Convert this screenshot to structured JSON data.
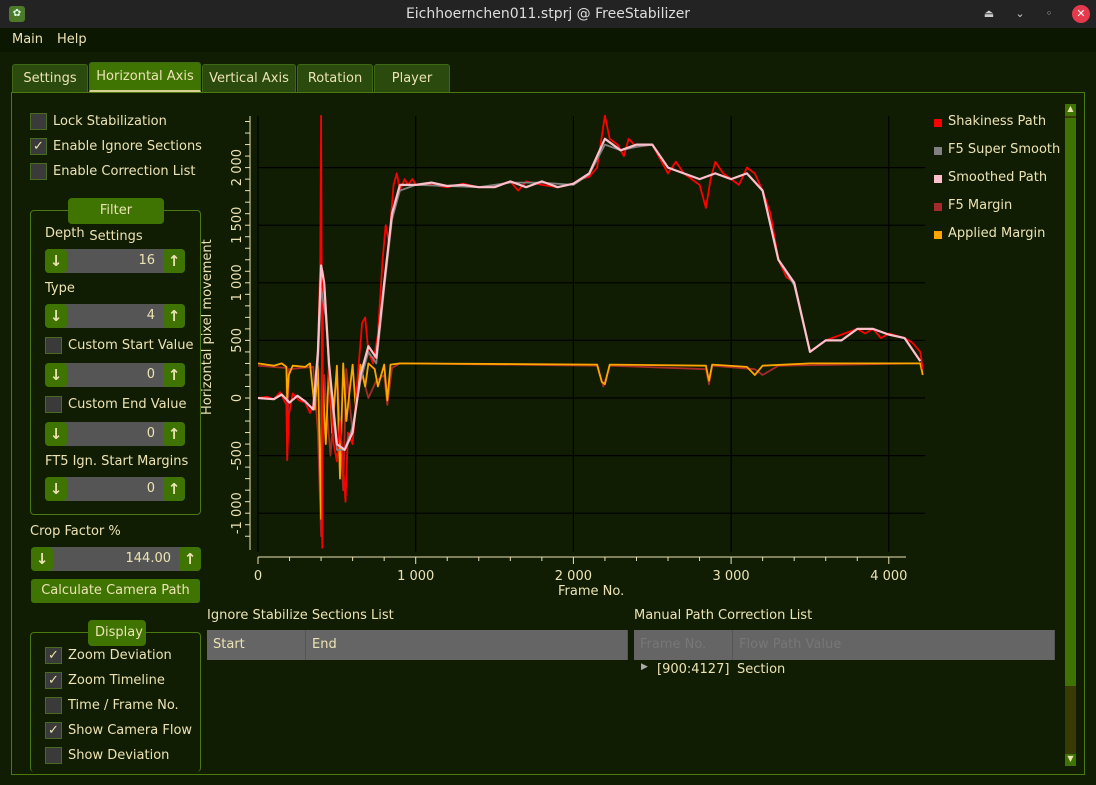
{
  "window": {
    "title": "Eichhoernchen011.stprj @ FreeStabilizer",
    "icon": "app-squirrel-icon",
    "controls": [
      "keep-above-icon",
      "minimize-icon",
      "restore-icon",
      "close-icon"
    ]
  },
  "menu": [
    "Main",
    "Help"
  ],
  "tabs": [
    {
      "label": "Settings"
    },
    {
      "label": "Horizontal Axis",
      "active": true
    },
    {
      "label": "Vertical Axis"
    },
    {
      "label": "Rotation"
    },
    {
      "label": "Player"
    }
  ],
  "options": {
    "lock": {
      "label": "Lock Stabilization",
      "checked": false
    },
    "ignore": {
      "label": "Enable Ignore Sections",
      "checked": true
    },
    "correction": {
      "label": "Enable Correction List",
      "checked": false
    }
  },
  "filter": {
    "title": "Filter Settings",
    "depth_label": "Depth",
    "depth": "16",
    "type_label": "Type",
    "type": "4",
    "custom_start_label": "Custom Start Value",
    "custom_start_checked": false,
    "custom_start": "0",
    "custom_end_label": "Custom End Value",
    "custom_end_checked": false,
    "custom_end": "0",
    "ft5_label": "FT5 Ign. Start Margins",
    "ft5": "0"
  },
  "crop": {
    "label": "Crop Factor %",
    "value": "144.00"
  },
  "calc_button": "Calculate Camera Path",
  "display": {
    "title": "Display",
    "items": [
      {
        "label": "Zoom Deviation",
        "checked": true
      },
      {
        "label": "Zoom Timeline",
        "checked": true
      },
      {
        "label": " Time / Frame No.",
        "checked": false
      },
      {
        "label": "Show Camera Flow",
        "checked": true
      },
      {
        "label": "Show Deviation",
        "checked": false
      }
    ]
  },
  "ignore_list": {
    "title": "Ignore Stabilize Sections List",
    "columns": [
      "Start",
      "End"
    ]
  },
  "correction_list": {
    "title": "Manual Path Correction List",
    "columns": [
      "Frame No.",
      "Flow Path Value"
    ],
    "rows": [
      {
        "frames": "[900:4127]",
        "value": "Section"
      }
    ]
  },
  "colors": {
    "accent": "#3f7403",
    "text": "#ece3b4",
    "background": "#111d02"
  },
  "chart_data": {
    "type": "line",
    "xlabel": "Frame No.",
    "ylabel": "Horizontal pixel movement",
    "xlim": [
      0,
      4220
    ],
    "ylim": [
      -1300,
      2450
    ],
    "grid": true,
    "legend_placement": "right",
    "xticks": [
      "0",
      "1 000",
      "2 000",
      "3 000",
      "4 000"
    ],
    "xtick_values": [
      0,
      1000,
      2000,
      3000,
      4000
    ],
    "yticks": [
      "-1 000",
      "-500",
      "0",
      "500",
      "1 000",
      "1 500",
      "2 000"
    ],
    "ytick_values": [
      -1000,
      -500,
      0,
      500,
      1000,
      1500,
      2000
    ],
    "series": [
      {
        "name": "Shakiness Path",
        "color": "#ff0000",
        "points": [
          [
            0,
            0
          ],
          [
            60,
            10
          ],
          [
            100,
            -10
          ],
          [
            140,
            50
          ],
          [
            180,
            -60
          ],
          [
            185,
            -540
          ],
          [
            195,
            -150
          ],
          [
            220,
            40
          ],
          [
            260,
            -20
          ],
          [
            300,
            -40
          ],
          [
            330,
            -130
          ],
          [
            350,
            -60
          ],
          [
            380,
            400
          ],
          [
            395,
            1200
          ],
          [
            400,
            2450
          ],
          [
            403,
            1300
          ],
          [
            408,
            -1300
          ],
          [
            412,
            1100
          ],
          [
            430,
            800
          ],
          [
            450,
            200
          ],
          [
            480,
            -400
          ],
          [
            500,
            -550
          ],
          [
            520,
            -200
          ],
          [
            540,
            -600
          ],
          [
            555,
            -900
          ],
          [
            570,
            -300
          ],
          [
            600,
            -400
          ],
          [
            630,
            150
          ],
          [
            660,
            650
          ],
          [
            680,
            700
          ],
          [
            700,
            400
          ],
          [
            730,
            300
          ],
          [
            760,
            550
          ],
          [
            790,
            1200
          ],
          [
            810,
            1500
          ],
          [
            830,
            1350
          ],
          [
            860,
            1850
          ],
          [
            880,
            1950
          ],
          [
            900,
            1800
          ],
          [
            930,
            1900
          ],
          [
            950,
            1850
          ],
          [
            980,
            1900
          ],
          [
            1000,
            1850
          ],
          [
            1100,
            1850
          ],
          [
            1200,
            1830
          ],
          [
            1300,
            1860
          ],
          [
            1400,
            1830
          ],
          [
            1500,
            1840
          ],
          [
            1600,
            1880
          ],
          [
            1650,
            1800
          ],
          [
            1700,
            1880
          ],
          [
            1800,
            1850
          ],
          [
            1900,
            1830
          ],
          [
            2000,
            1860
          ],
          [
            2050,
            1900
          ],
          [
            2100,
            1920
          ],
          [
            2150,
            2000
          ],
          [
            2200,
            2450
          ],
          [
            2230,
            2250
          ],
          [
            2280,
            2200
          ],
          [
            2320,
            2100
          ],
          [
            2350,
            2250
          ],
          [
            2400,
            2180
          ],
          [
            2500,
            2200
          ],
          [
            2600,
            1950
          ],
          [
            2650,
            2050
          ],
          [
            2700,
            1950
          ],
          [
            2800,
            1850
          ],
          [
            2840,
            1650
          ],
          [
            2870,
            1900
          ],
          [
            2900,
            2050
          ],
          [
            2950,
            1950
          ],
          [
            3000,
            1900
          ],
          [
            3050,
            1850
          ],
          [
            3100,
            2000
          ],
          [
            3150,
            1950
          ],
          [
            3200,
            1800
          ],
          [
            3250,
            1600
          ],
          [
            3300,
            1200
          ],
          [
            3350,
            1050
          ],
          [
            3400,
            1000
          ],
          [
            3450,
            700
          ],
          [
            3500,
            400
          ],
          [
            3550,
            450
          ],
          [
            3600,
            500
          ],
          [
            3700,
            550
          ],
          [
            3800,
            600
          ],
          [
            3850,
            560
          ],
          [
            3900,
            600
          ],
          [
            3950,
            520
          ],
          [
            4000,
            560
          ],
          [
            4100,
            520
          ],
          [
            4150,
            480
          ],
          [
            4200,
            400
          ],
          [
            4215,
            250
          ]
        ]
      },
      {
        "name": "F5 Super Smooth",
        "color": "#808080",
        "points": [
          [
            0,
            0
          ],
          [
            100,
            -10
          ],
          [
            150,
            30
          ],
          [
            200,
            -40
          ],
          [
            250,
            20
          ],
          [
            300,
            -30
          ],
          [
            350,
            -100
          ],
          [
            380,
            300
          ],
          [
            400,
            950
          ],
          [
            430,
            700
          ],
          [
            460,
            100
          ],
          [
            500,
            -450
          ],
          [
            550,
            -450
          ],
          [
            600,
            -250
          ],
          [
            650,
            150
          ],
          [
            700,
            400
          ],
          [
            750,
            300
          ],
          [
            800,
            950
          ],
          [
            850,
            1550
          ],
          [
            900,
            1800
          ],
          [
            1000,
            1850
          ],
          [
            1200,
            1840
          ],
          [
            1400,
            1830
          ],
          [
            1600,
            1870
          ],
          [
            1800,
            1870
          ],
          [
            2000,
            1850
          ],
          [
            2100,
            1940
          ],
          [
            2200,
            2200
          ],
          [
            2300,
            2150
          ],
          [
            2400,
            2180
          ],
          [
            2500,
            2200
          ],
          [
            2600,
            2000
          ],
          [
            2700,
            1950
          ],
          [
            2800,
            1900
          ],
          [
            2900,
            1950
          ],
          [
            3000,
            1900
          ],
          [
            3100,
            1950
          ],
          [
            3200,
            1800
          ],
          [
            3300,
            1200
          ],
          [
            3400,
            980
          ],
          [
            3500,
            400
          ],
          [
            3600,
            500
          ],
          [
            3700,
            500
          ],
          [
            3800,
            600
          ],
          [
            3900,
            600
          ],
          [
            4000,
            550
          ],
          [
            4100,
            520
          ],
          [
            4200,
            320
          ]
        ]
      },
      {
        "name": "Smoothed Path",
        "color": "#ffc0cb",
        "points": [
          [
            0,
            0
          ],
          [
            100,
            -10
          ],
          [
            150,
            30
          ],
          [
            200,
            -40
          ],
          [
            250,
            20
          ],
          [
            300,
            -30
          ],
          [
            350,
            -100
          ],
          [
            380,
            400
          ],
          [
            400,
            1150
          ],
          [
            420,
            1000
          ],
          [
            450,
            300
          ],
          [
            500,
            -400
          ],
          [
            550,
            -450
          ],
          [
            600,
            -300
          ],
          [
            650,
            200
          ],
          [
            700,
            450
          ],
          [
            750,
            350
          ],
          [
            800,
            1000
          ],
          [
            850,
            1600
          ],
          [
            900,
            1850
          ],
          [
            1000,
            1850
          ],
          [
            1100,
            1870
          ],
          [
            1200,
            1840
          ],
          [
            1300,
            1850
          ],
          [
            1400,
            1830
          ],
          [
            1500,
            1830
          ],
          [
            1600,
            1880
          ],
          [
            1700,
            1830
          ],
          [
            1800,
            1880
          ],
          [
            1900,
            1830
          ],
          [
            2000,
            1860
          ],
          [
            2100,
            1950
          ],
          [
            2200,
            2250
          ],
          [
            2300,
            2150
          ],
          [
            2400,
            2200
          ],
          [
            2500,
            2200
          ],
          [
            2600,
            2000
          ],
          [
            2700,
            1950
          ],
          [
            2800,
            1900
          ],
          [
            2900,
            1950
          ],
          [
            3000,
            1900
          ],
          [
            3100,
            1950
          ],
          [
            3200,
            1800
          ],
          [
            3300,
            1200
          ],
          [
            3400,
            1000
          ],
          [
            3500,
            400
          ],
          [
            3600,
            500
          ],
          [
            3700,
            500
          ],
          [
            3800,
            600
          ],
          [
            3900,
            600
          ],
          [
            4000,
            550
          ],
          [
            4100,
            520
          ],
          [
            4200,
            320
          ]
        ]
      },
      {
        "name": "F5 Margin",
        "color": "#a52a2a",
        "points": [
          [
            0,
            280
          ],
          [
            180,
            260
          ],
          [
            185,
            -400
          ],
          [
            195,
            250
          ],
          [
            350,
            270
          ],
          [
            380,
            -300
          ],
          [
            400,
            -1200
          ],
          [
            420,
            200
          ],
          [
            460,
            -500
          ],
          [
            500,
            250
          ],
          [
            540,
            -800
          ],
          [
            560,
            250
          ],
          [
            600,
            -300
          ],
          [
            650,
            250
          ],
          [
            700,
            0
          ],
          [
            750,
            150
          ],
          [
            800,
            200
          ],
          [
            820,
            -60
          ],
          [
            850,
            260
          ],
          [
            900,
            300
          ],
          [
            2150,
            280
          ],
          [
            2190,
            100
          ],
          [
            2230,
            280
          ],
          [
            2840,
            250
          ],
          [
            2860,
            120
          ],
          [
            2880,
            280
          ],
          [
            3150,
            250
          ],
          [
            3200,
            200
          ],
          [
            3300,
            280
          ],
          [
            4200,
            300
          ],
          [
            4215,
            230
          ]
        ]
      },
      {
        "name": "Applied Margin",
        "color": "#ffa500",
        "points": [
          [
            0,
            300
          ],
          [
            100,
            280
          ],
          [
            150,
            300
          ],
          [
            180,
            270
          ],
          [
            185,
            0
          ],
          [
            195,
            200
          ],
          [
            220,
            280
          ],
          [
            300,
            270
          ],
          [
            330,
            300
          ],
          [
            360,
            -100
          ],
          [
            380,
            280
          ],
          [
            395,
            -700
          ],
          [
            400,
            -1050
          ],
          [
            405,
            300
          ],
          [
            430,
            -400
          ],
          [
            450,
            280
          ],
          [
            470,
            -300
          ],
          [
            500,
            280
          ],
          [
            520,
            -700
          ],
          [
            540,
            300
          ],
          [
            560,
            -200
          ],
          [
            600,
            290
          ],
          [
            620,
            -100
          ],
          [
            650,
            290
          ],
          [
            680,
            100
          ],
          [
            700,
            300
          ],
          [
            740,
            250
          ],
          [
            760,
            100
          ],
          [
            800,
            290
          ],
          [
            820,
            -20
          ],
          [
            840,
            290
          ],
          [
            900,
            300
          ],
          [
            2150,
            290
          ],
          [
            2180,
            140
          ],
          [
            2200,
            120
          ],
          [
            2230,
            290
          ],
          [
            2840,
            280
          ],
          [
            2860,
            150
          ],
          [
            2880,
            290
          ],
          [
            3100,
            270
          ],
          [
            3150,
            200
          ],
          [
            3200,
            280
          ],
          [
            3500,
            300
          ],
          [
            4200,
            300
          ],
          [
            4215,
            200
          ]
        ]
      }
    ]
  }
}
